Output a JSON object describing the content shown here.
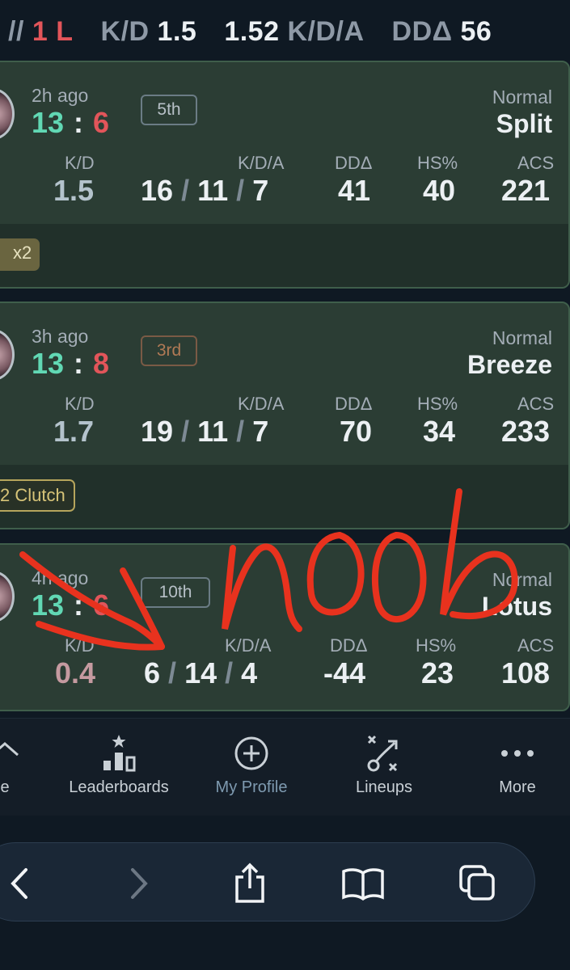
{
  "summary": {
    "prefix": "//",
    "losses": "1 L",
    "kd_label": "K/D",
    "kd_value": "1.5",
    "kda_value": "1.52",
    "kda_label": "K/D/A",
    "dd_label": "DDΔ",
    "dd_value": "56"
  },
  "matches": [
    {
      "ago": "2h ago",
      "won": "13",
      "colon": ":",
      "lost": "6",
      "placement": "5th",
      "mode": "Normal",
      "map": "Split",
      "labels": {
        "kd": "K/D",
        "kda": "K/D/A",
        "dd": "DDΔ",
        "hs": "HS%",
        "acs": "ACS"
      },
      "kd": "1.5",
      "kills": "16",
      "deaths": "11",
      "assists": "7",
      "slash": "/",
      "dd": "41",
      "hs": "40",
      "acs": "221",
      "badge": "x2"
    },
    {
      "ago": "3h ago",
      "won": "13",
      "colon": ":",
      "lost": "8",
      "placement": "3rd",
      "mode": "Normal",
      "map": "Breeze",
      "labels": {
        "kd": "K/D",
        "kda": "K/D/A",
        "dd": "DDΔ",
        "hs": "HS%",
        "acs": "ACS"
      },
      "kd": "1.7",
      "kills": "19",
      "deaths": "11",
      "assists": "7",
      "slash": "/",
      "dd": "70",
      "hs": "34",
      "acs": "233",
      "badge": "2 Clutch"
    },
    {
      "ago": "4h ago",
      "won": "13",
      "colon": ":",
      "lost": "6",
      "placement": "10th",
      "mode": "Normal",
      "map": "Lotus",
      "labels": {
        "kd": "K/D",
        "kda": "K/D/A",
        "dd": "DDΔ",
        "hs": "HS%",
        "acs": "ACS"
      },
      "kd": "0.4",
      "kills": "6",
      "deaths": "14",
      "assists": "4",
      "slash": "/",
      "dd": "-44",
      "hs": "23",
      "acs": "108"
    }
  ],
  "nav": {
    "home_partial": "e",
    "leaderboards": "Leaderboards",
    "my_profile": "My Profile",
    "lineups": "Lineups",
    "more": "More"
  },
  "browser": {
    "icons": [
      "back-icon",
      "forward-icon",
      "share-icon",
      "bookmarks-icon",
      "tabs-icon"
    ]
  },
  "annotation": {
    "text": "noob",
    "color": "#e8321e"
  }
}
